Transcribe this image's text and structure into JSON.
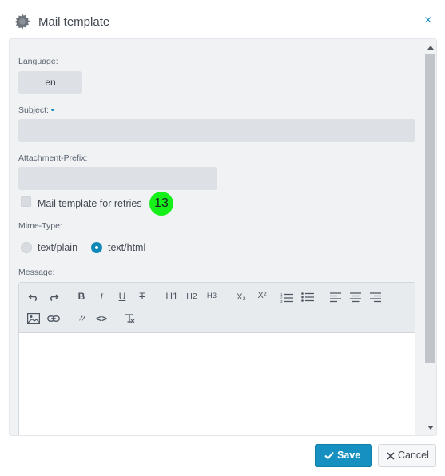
{
  "dialog": {
    "title": "Mail template",
    "close": "×"
  },
  "form": {
    "language_label": "Language:",
    "language_value": "en",
    "subject_label": "Subject:",
    "subject_required": "•",
    "subject_value": "",
    "attachment_prefix_label": "Attachment-Prefix:",
    "attachment_prefix_value": "",
    "retries_checkbox_label": "Mail template for retries",
    "retries_checked": false,
    "badge": "13",
    "mime_type_label": "Mime-Type:",
    "mime_options": [
      "text/plain",
      "text/html"
    ],
    "mime_selected": "text/html",
    "message_label": "Message:",
    "message_value": ""
  },
  "toolbar": {
    "undo": "undo-icon",
    "redo": "redo-icon",
    "bold": "B",
    "italic": "I",
    "underline": "U",
    "strike": "T",
    "h1": "H1",
    "h2": "H2",
    "h3": "H3",
    "subscript": "X₂",
    "superscript": "X²",
    "ordered_list": "ordered-list-icon",
    "bullet_list": "bullet-list-icon",
    "align_left": "align-left-icon",
    "align_center": "align-center-icon",
    "align_right": "align-right-icon",
    "image": "image-icon",
    "link": "link-icon",
    "quote": "〃",
    "code": "<>",
    "clear_format": "clear-format-icon"
  },
  "buttons": {
    "save": "Save",
    "cancel": "Cancel"
  },
  "colors": {
    "accent": "#1089b8",
    "badge": "#16f019",
    "input_bg": "#dde1e6",
    "panel_bg": "#f1f2f4"
  }
}
